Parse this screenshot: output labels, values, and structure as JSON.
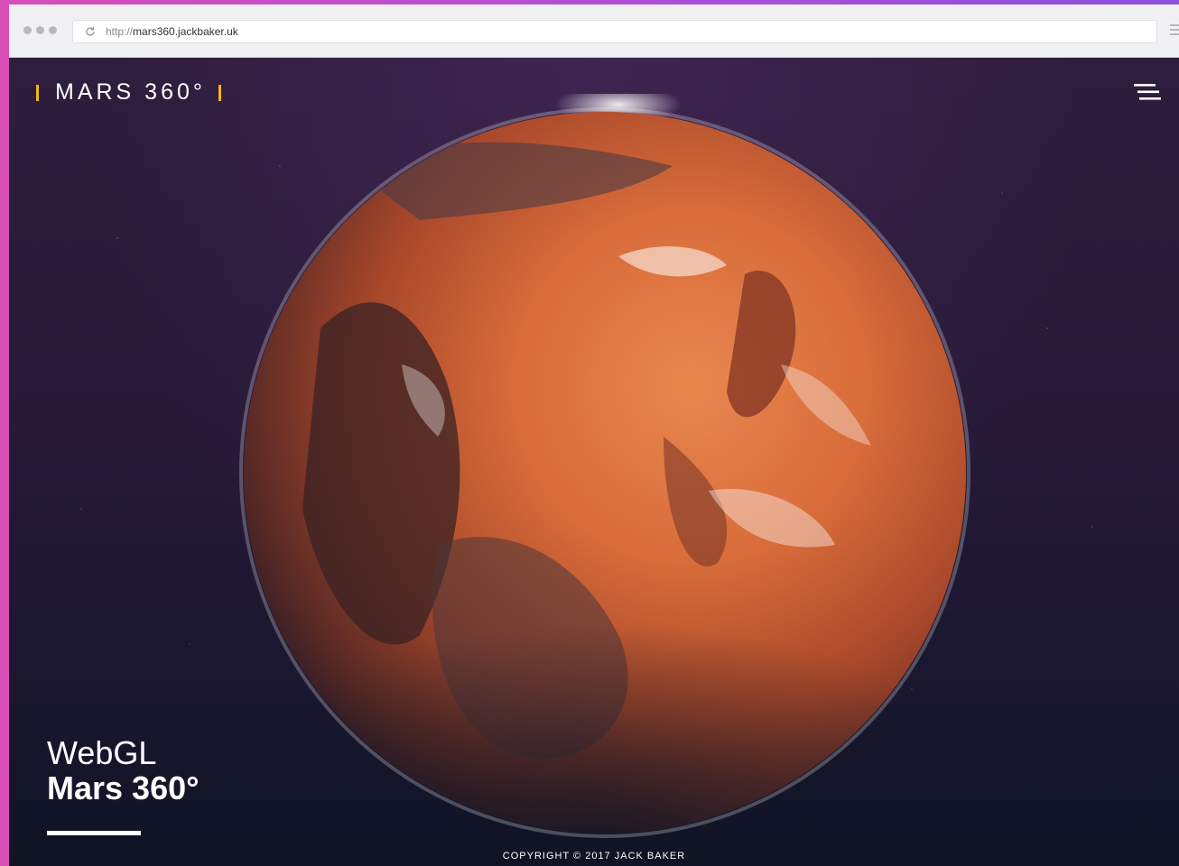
{
  "browser": {
    "url_protocol": "http://",
    "url_host": "mars360.jackbaker.uk"
  },
  "header": {
    "logo_text": "MARS 360°",
    "accent_color": "#f2b71b",
    "menu_icon": "hamburger-icon"
  },
  "hero": {
    "subtitle": "WebGL",
    "title": "Mars 360°"
  },
  "footer": {
    "copyright": "COPYRIGHT © 2017 JACK BAKER"
  }
}
